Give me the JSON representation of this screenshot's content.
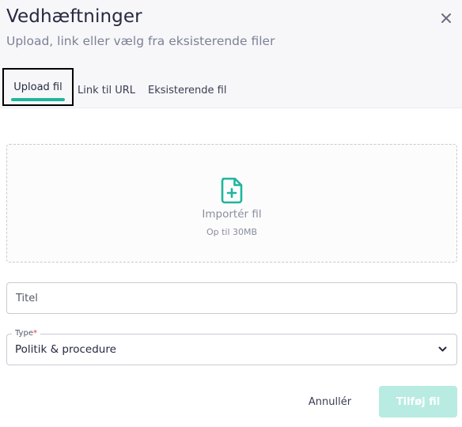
{
  "dialog": {
    "title": "Vedhæftninger",
    "subtitle": "Upload, link eller vælg fra eksisterende filer",
    "close_icon": "close-icon"
  },
  "tabs": [
    {
      "label": "Upload fil",
      "active": true
    },
    {
      "label": "Link til URL",
      "active": false
    },
    {
      "label": "Eksisterende fil",
      "active": false
    }
  ],
  "upload": {
    "icon": "file-plus-icon",
    "label": "Importér fil",
    "hint": "Op til 30MB"
  },
  "form": {
    "title_placeholder": "Titel",
    "type_label": "Type",
    "type_required_mark": "*",
    "type_value": "Politik & procedure"
  },
  "actions": {
    "cancel_label": "Annullér",
    "submit_label": "Tilføj fil"
  },
  "colors": {
    "accent": "#1fb69c",
    "submit_disabled": "#b8ebe2",
    "required": "#e4344f"
  }
}
